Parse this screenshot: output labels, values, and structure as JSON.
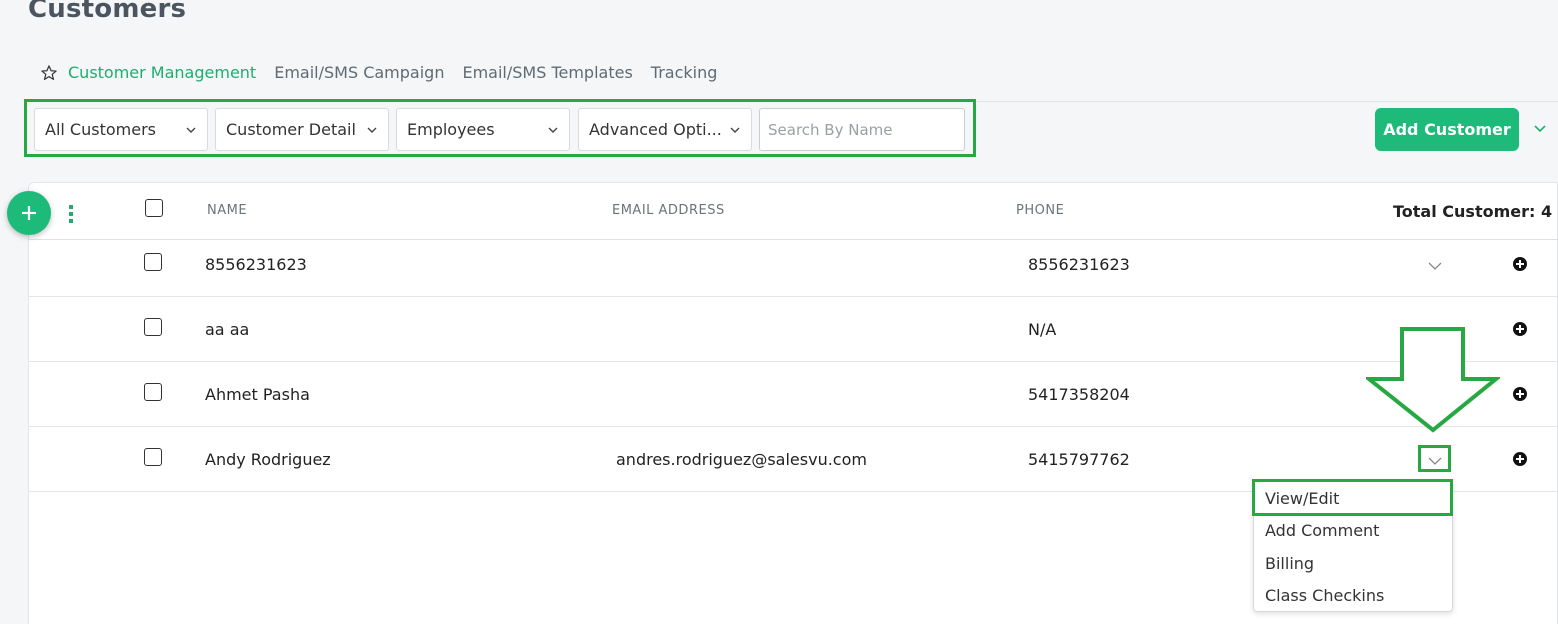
{
  "page": {
    "title": "Customers"
  },
  "tabs": [
    {
      "label": "Customer Management",
      "active": true
    },
    {
      "label": "Email/SMS Campaign",
      "active": false
    },
    {
      "label": "Email/SMS Templates",
      "active": false
    },
    {
      "label": "Tracking",
      "active": false
    }
  ],
  "filters": {
    "customers": "All Customers",
    "detail": "Customer Detail",
    "employees": "Employees",
    "advanced": "Advanced Opti...",
    "search_placeholder": "Search By Name"
  },
  "actions": {
    "add_customer": "Add Customer"
  },
  "table": {
    "columns": {
      "name": "NAME",
      "email": "EMAIL ADDRESS",
      "phone": "PHONE"
    },
    "total_label": "Total Customer: 4",
    "rows": [
      {
        "name": "8556231623",
        "email": "",
        "phone": "8556231623"
      },
      {
        "name": "aa aa",
        "email": "",
        "phone": "N/A"
      },
      {
        "name": "Ahmet Pasha",
        "email": "",
        "phone": "5417358204"
      },
      {
        "name": "Andy Rodriguez",
        "email": "andres.rodriguez@salesvu.com",
        "phone": "5415797762"
      }
    ]
  },
  "row_menu": {
    "items": [
      "View/Edit",
      "Add Comment",
      "Billing",
      "Class Checkins"
    ]
  },
  "colors": {
    "accent": "#1dba7a",
    "annotation": "#27a843"
  },
  "icons": [
    "star-icon",
    "chevron-down-icon",
    "plus-icon",
    "kebab-icon",
    "plus-circle-icon",
    "arrow-down-annotation"
  ]
}
